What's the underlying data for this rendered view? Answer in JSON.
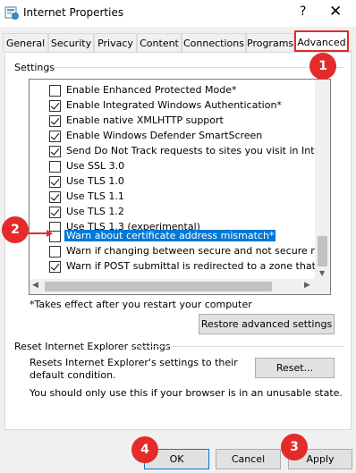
{
  "window": {
    "title": "Internet Properties",
    "help_glyph": "?",
    "close_glyph": "✕"
  },
  "tabs": [
    {
      "label": "General"
    },
    {
      "label": "Security"
    },
    {
      "label": "Privacy"
    },
    {
      "label": "Content"
    },
    {
      "label": "Connections"
    },
    {
      "label": "Programs"
    },
    {
      "label": "Advanced",
      "active": true
    }
  ],
  "settings": {
    "group_label": "Settings",
    "items": [
      {
        "label": "Enable Enhanced Protected Mode*",
        "checked": false
      },
      {
        "label": "Enable Integrated Windows Authentication*",
        "checked": true
      },
      {
        "label": "Enable native XMLHTTP support",
        "checked": true
      },
      {
        "label": "Enable Windows Defender SmartScreen",
        "checked": true
      },
      {
        "label": "Send Do Not Track requests to sites you visit in Internet E",
        "checked": true
      },
      {
        "label": "Use SSL 3.0",
        "checked": false
      },
      {
        "label": "Use TLS 1.0",
        "checked": true
      },
      {
        "label": "Use TLS 1.1",
        "checked": true
      },
      {
        "label": "Use TLS 1.2",
        "checked": true
      },
      {
        "label": "Use TLS 1.3 (experimental)",
        "checked": false
      },
      {
        "label": "Warn about certificate address mismatch*",
        "checked": false,
        "selected": true
      },
      {
        "label": "Warn if changing between secure and not secure mode",
        "checked": false
      },
      {
        "label": "Warn if POST submittal is redirected to a zone that does n",
        "checked": true
      }
    ],
    "note": "*Takes effect after you restart your computer",
    "restore_button": "Restore advanced settings"
  },
  "reset": {
    "group_label": "Reset Internet Explorer settings",
    "description": "Resets Internet Explorer's settings to their default condition.",
    "button": "Reset...",
    "warning": "You should only use this if your browser is in an unusable state."
  },
  "footer": {
    "ok": "OK",
    "cancel": "Cancel",
    "apply": "Apply"
  },
  "annotations": [
    {
      "number": "1"
    },
    {
      "number": "2"
    },
    {
      "number": "3"
    },
    {
      "number": "4"
    }
  ],
  "colors": {
    "accent_red": "#e42a2a",
    "selection_blue": "#0078d7"
  }
}
